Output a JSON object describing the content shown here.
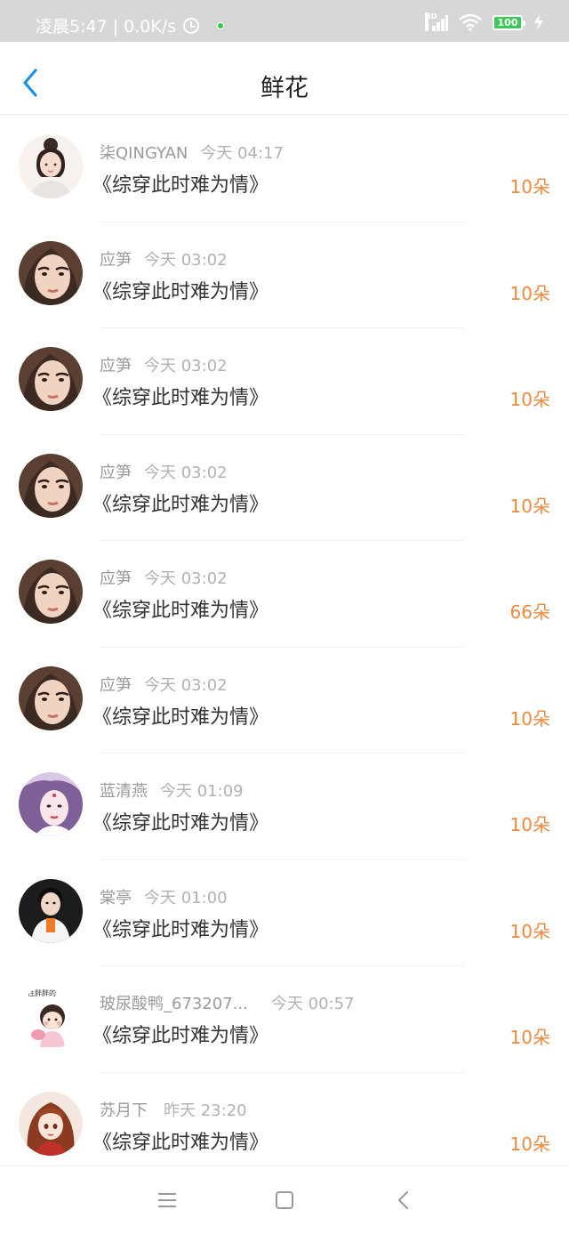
{
  "status_bar": {
    "time_speed": "凌晨5:47 | 0.0K/s",
    "battery_level": "100",
    "icons": [
      "alarm-icon",
      "notification-dot",
      "signal-icon",
      "wifi-icon",
      "battery-icon",
      "charging-icon"
    ]
  },
  "header": {
    "title": "鲜花",
    "back_icon": "chevron-left-icon"
  },
  "colors": {
    "accent": "#1a8fe8",
    "count": "#ec8a3e",
    "status_bar_bg": "#d7d7d7"
  },
  "gifts": [
    {
      "user": "柒QINGYAN",
      "time": "今天 04:17",
      "book": "《综穿此时难为情》",
      "count": "10朵",
      "avatar": "avatar-illustrated-girl"
    },
    {
      "user": "应笋",
      "time": "今天 03:02",
      "book": "《综穿此时难为情》",
      "count": "10朵",
      "avatar": "avatar-woman-photo"
    },
    {
      "user": "应笋",
      "time": "今天 03:02",
      "book": "《综穿此时难为情》",
      "count": "10朵",
      "avatar": "avatar-woman-photo"
    },
    {
      "user": "应笋",
      "time": "今天 03:02",
      "book": "《综穿此时难为情》",
      "count": "10朵",
      "avatar": "avatar-woman-photo"
    },
    {
      "user": "应笋",
      "time": "今天 03:02",
      "book": "《综穿此时难为情》",
      "count": "66朵",
      "avatar": "avatar-woman-photo"
    },
    {
      "user": "应笋",
      "time": "今天 03:02",
      "book": "《综穿此时难为情》",
      "count": "10朵",
      "avatar": "avatar-woman-photo"
    },
    {
      "user": "蓝清燕",
      "time": "今天 01:09",
      "book": "《综穿此时难为情》",
      "count": "10朵",
      "avatar": "avatar-costume-woman"
    },
    {
      "user": "棠亭",
      "time": "今天 01:00",
      "book": "《综穿此时难为情》",
      "count": "10朵",
      "avatar": "avatar-man-photo"
    },
    {
      "user": "玻尿酸鸭_673207...",
      "time": "今天 00:57",
      "book": "《综穿此时难为情》",
      "count": "10朵",
      "avatar": "avatar-cartoon-girl",
      "avatar_text": "往胖胖的"
    },
    {
      "user": "苏月下",
      "time": "昨天 23:20",
      "book": "《综穿此时难为情》",
      "count": "10朵",
      "avatar": "avatar-anime-girl"
    }
  ],
  "nav_bar": {
    "icons": [
      "menu-icon",
      "home-icon",
      "back-icon"
    ]
  }
}
